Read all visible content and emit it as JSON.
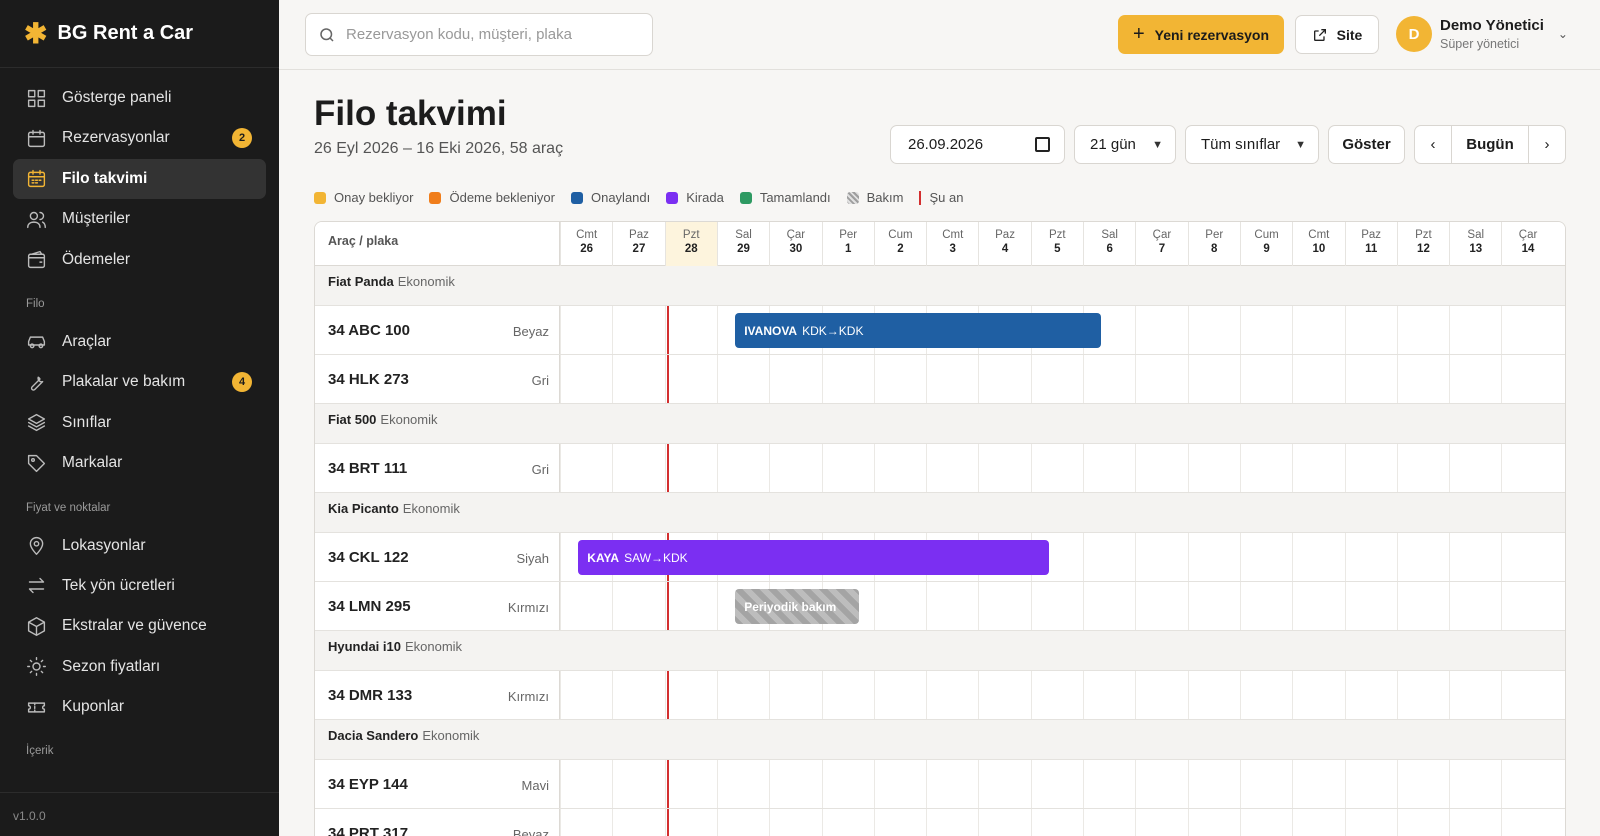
{
  "app": {
    "name": "BG Rent a Car",
    "version": "v1.0.0"
  },
  "sidebar": {
    "items": [
      {
        "label": "Gösterge paneli"
      },
      {
        "label": "Rezervasyonlar",
        "badge": "2"
      },
      {
        "label": "Filo takvimi",
        "active": true
      },
      {
        "label": "Müşteriler"
      },
      {
        "label": "Ödemeler"
      }
    ],
    "section_filo": "Filo",
    "filo_items": [
      {
        "label": "Araçlar"
      },
      {
        "label": "Plakalar ve bakım",
        "badge": "4"
      },
      {
        "label": "Sınıflar"
      },
      {
        "label": "Markalar"
      }
    ],
    "section_fiyat": "Fiyat ve noktalar",
    "fiyat_items": [
      {
        "label": "Lokasyonlar"
      },
      {
        "label": "Tek yön ücretleri"
      },
      {
        "label": "Ekstralar ve güvence"
      },
      {
        "label": "Sezon fiyatları"
      },
      {
        "label": "Kuponlar"
      }
    ],
    "section_icerik": "İçerik"
  },
  "header": {
    "search_placeholder": "Rezervasyon kodu, müşteri, plaka",
    "new_button": "Yeni rezervasyon",
    "site_button": "Site",
    "user_initial": "D",
    "user_name": "Demo Yönetici",
    "user_role": "Süper yönetici"
  },
  "page": {
    "title": "Filo takvimi",
    "subtitle": "26 Eyl 2026 – 16 Eki 2026, 58 araç",
    "date_value": "26.09.2026",
    "days_select": "21 gün",
    "class_select": "Tüm sınıflar",
    "show_button": "Göster",
    "today_button": "Bugün"
  },
  "legend": [
    {
      "label": "Onay bekliyor",
      "color": "#f2b534"
    },
    {
      "label": "Ödeme bekleniyor",
      "color": "#f07d1a"
    },
    {
      "label": "Onaylandı",
      "color": "#1f5fa3"
    },
    {
      "label": "Kirada",
      "color": "#7b2ff2"
    },
    {
      "label": "Tamamlandı",
      "color": "#2e9a62"
    },
    {
      "label": "Bakım",
      "color": "hatch"
    },
    {
      "label": "Şu an",
      "color": "#d32f2f"
    }
  ],
  "grid": {
    "header_label": "Araç / plaka",
    "days": [
      {
        "dow": "Cmt",
        "d": "26"
      },
      {
        "dow": "Paz",
        "d": "27"
      },
      {
        "dow": "Pzt",
        "d": "28",
        "today": true
      },
      {
        "dow": "Sal",
        "d": "29"
      },
      {
        "dow": "Çar",
        "d": "30"
      },
      {
        "dow": "Per",
        "d": "1"
      },
      {
        "dow": "Cum",
        "d": "2"
      },
      {
        "dow": "Cmt",
        "d": "3"
      },
      {
        "dow": "Paz",
        "d": "4"
      },
      {
        "dow": "Pzt",
        "d": "5"
      },
      {
        "dow": "Sal",
        "d": "6"
      },
      {
        "dow": "Çar",
        "d": "7"
      },
      {
        "dow": "Per",
        "d": "8"
      },
      {
        "dow": "Cum",
        "d": "9"
      },
      {
        "dow": "Cmt",
        "d": "10"
      },
      {
        "dow": "Paz",
        "d": "11"
      },
      {
        "dow": "Pzt",
        "d": "12"
      },
      {
        "dow": "Sal",
        "d": "13"
      },
      {
        "dow": "Çar",
        "d": "14"
      }
    ],
    "groups": [
      {
        "model": "Fiat Panda",
        "cls": "Ekonomik",
        "cars": [
          {
            "plate": "34 ABC 100",
            "color": "Beyaz"
          },
          {
            "plate": "34 HLK 273",
            "color": "Gri"
          }
        ]
      },
      {
        "model": "Fiat 500",
        "cls": "Ekonomik",
        "cars": [
          {
            "plate": "34 BRT 111",
            "color": "Gri"
          }
        ]
      },
      {
        "model": "Kia Picanto",
        "cls": "Ekonomik",
        "cars": [
          {
            "plate": "34 CKL 122",
            "color": "Siyah"
          },
          {
            "plate": "34 LMN 295",
            "color": "Kırmızı"
          }
        ]
      },
      {
        "model": "Hyundai i10",
        "cls": "Ekonomik",
        "cars": [
          {
            "plate": "34 DMR 133",
            "color": "Kırmızı"
          }
        ]
      },
      {
        "model": "Dacia Sandero",
        "cls": "Ekonomik",
        "cars": [
          {
            "plate": "34 EYP 144",
            "color": "Mavi"
          },
          {
            "plate": "34 PRT 317",
            "color": "Beyaz"
          }
        ]
      }
    ],
    "bookings": [
      {
        "car": "34 ABC 100",
        "name": "IVANOVA",
        "route": "KDK→KDK",
        "type": "Onaylandı",
        "start_day": 3.35,
        "end_day": 10.35
      },
      {
        "car": "34 CKL 122",
        "name": "KAYA",
        "route": "SAW→KDK",
        "type": "Kirada",
        "start_day": 0.35,
        "end_day": 9.35
      },
      {
        "car": "34 LMN 295",
        "name": "Periyodik bakım",
        "route": "",
        "type": "Bakım",
        "start_day": 3.35,
        "end_day": 5.72
      }
    ],
    "now_day": 2.05
  }
}
